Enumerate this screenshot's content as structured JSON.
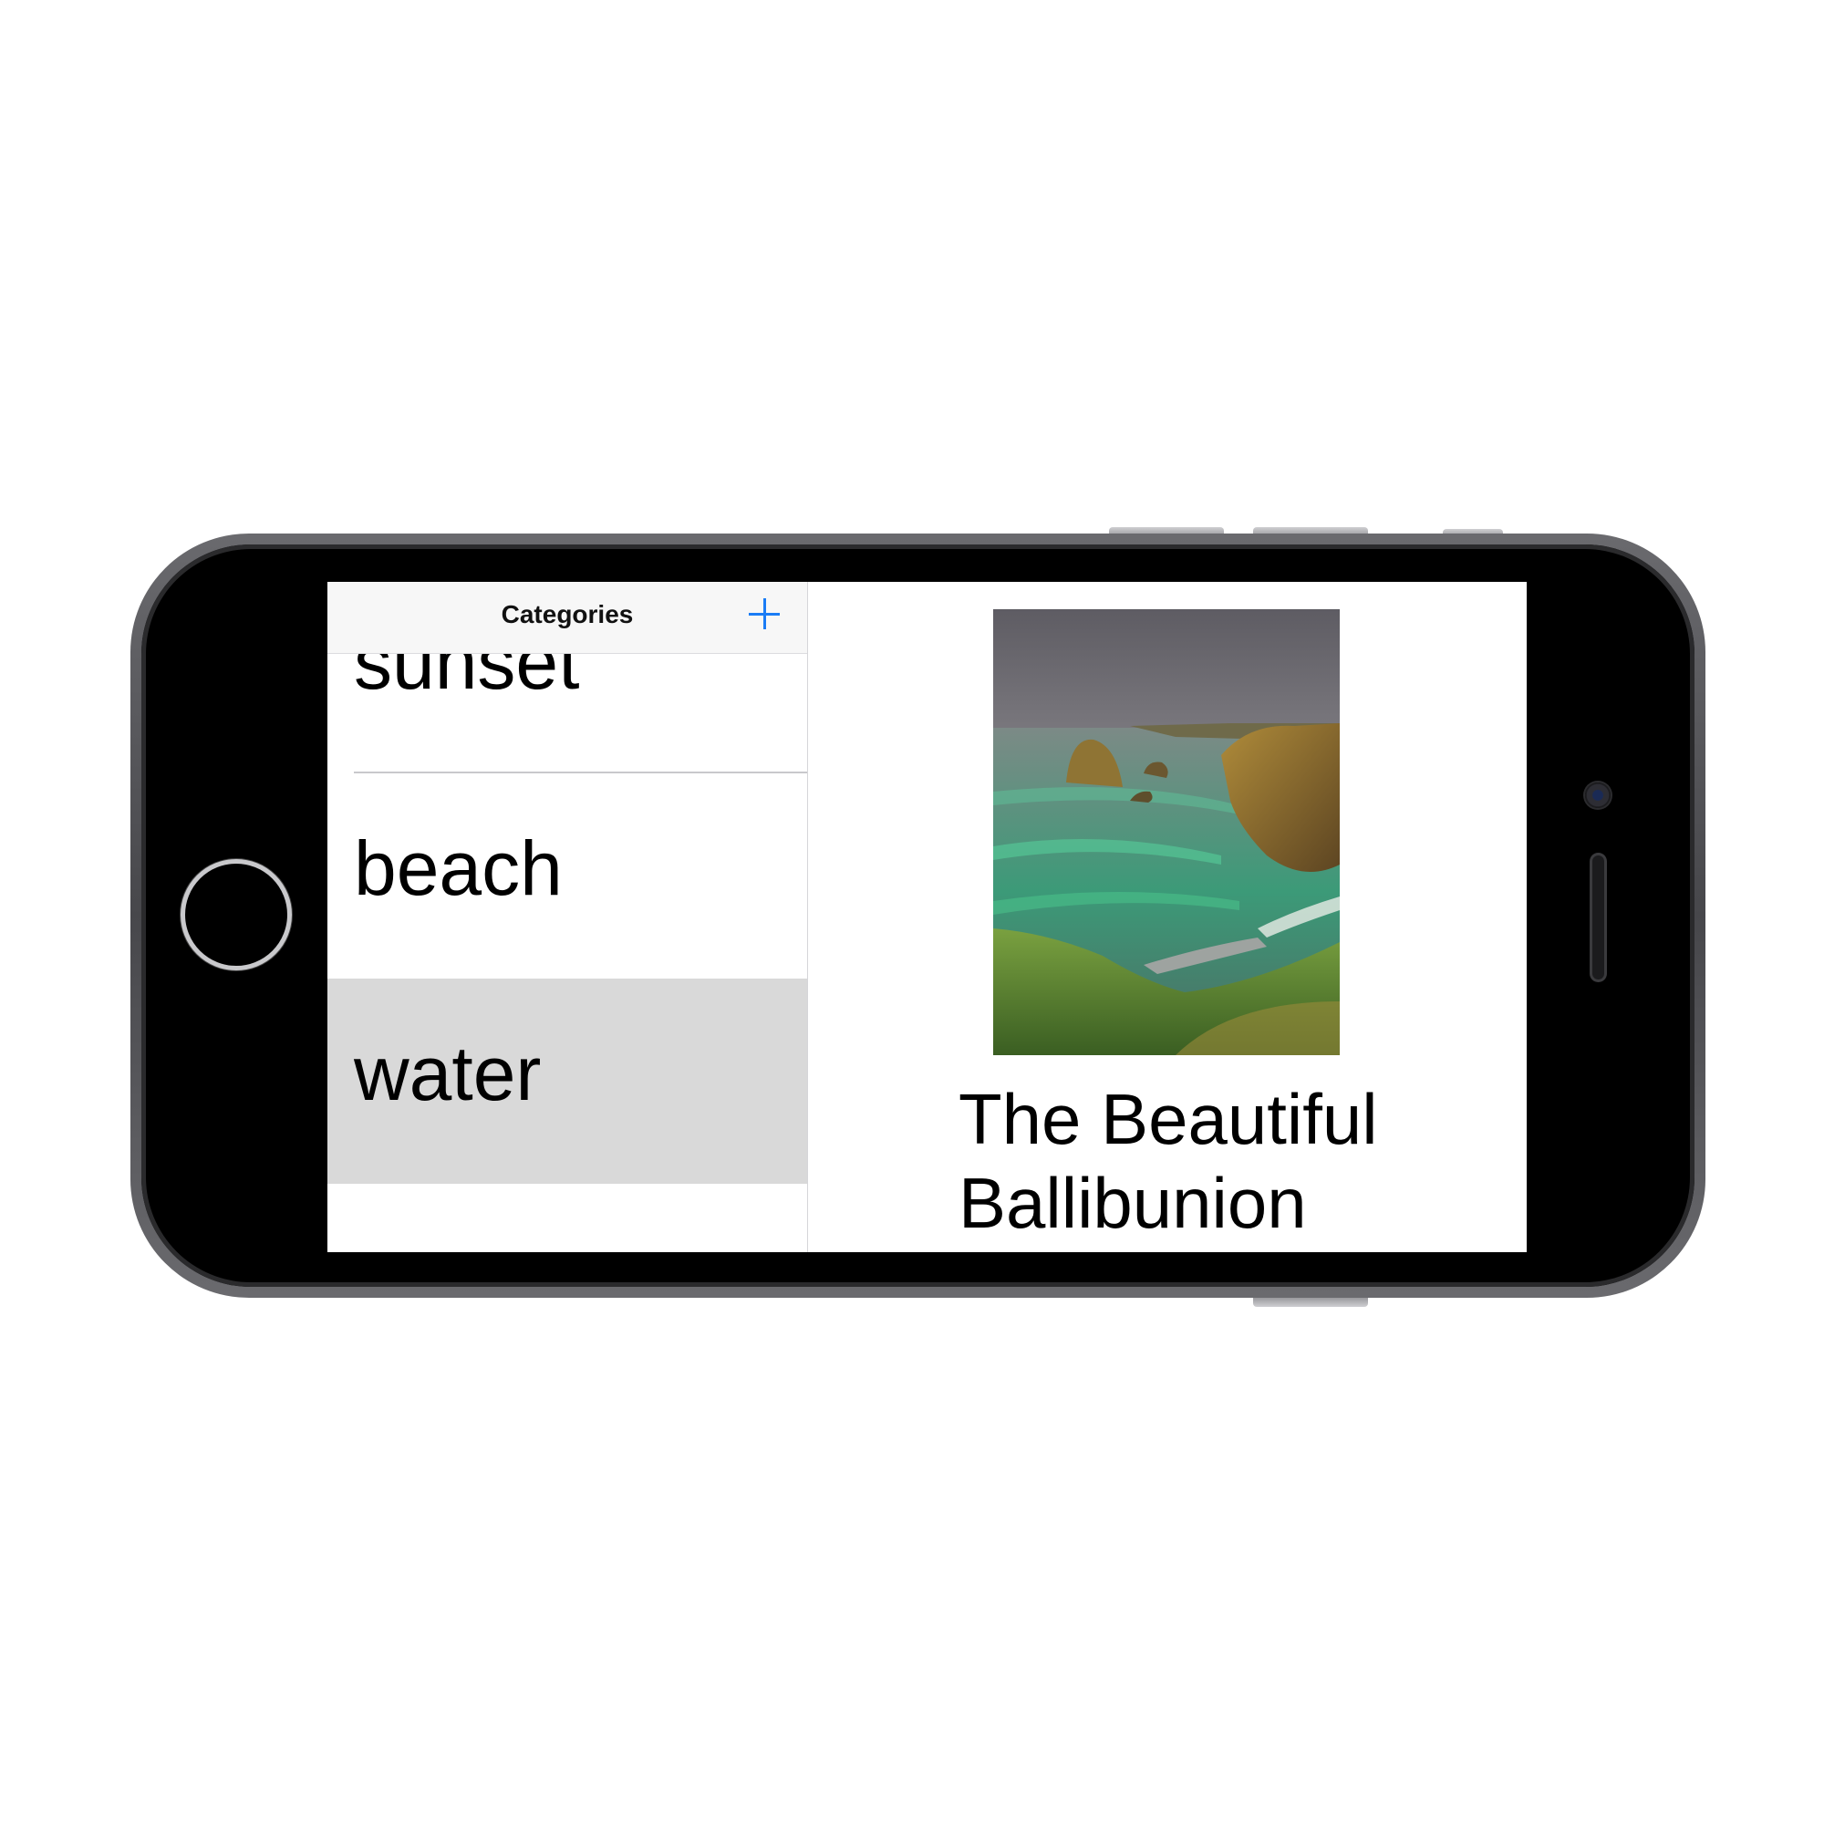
{
  "nav": {
    "title": "Categories",
    "add_icon": "plus-icon"
  },
  "categories": [
    {
      "label": "sunset",
      "selected": false
    },
    {
      "label": "beach",
      "selected": false
    },
    {
      "label": "water",
      "selected": true
    }
  ],
  "detail": {
    "photo_subject": "coastal cliffs and green sea at Ballybunion",
    "caption_line1": "The Beautiful",
    "caption_line2": "Ballibunion"
  },
  "colors": {
    "accent": "#1a7cf5",
    "selected_row": "#d9d9d9",
    "device_frame": "#58585c"
  }
}
